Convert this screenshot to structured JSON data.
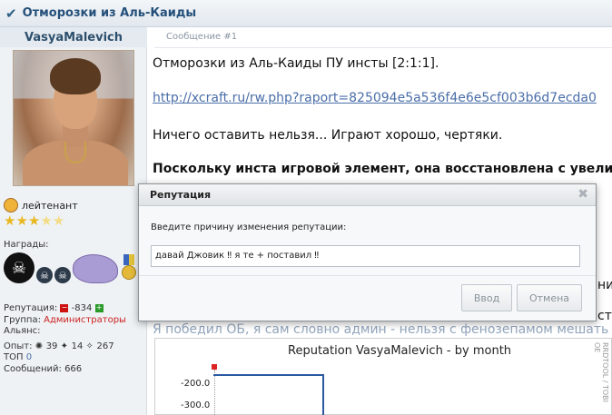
{
  "thread": {
    "title": "Отморозки из Аль-Каиды"
  },
  "user": {
    "name": "VasyaMalevich",
    "rank": "лейтенант",
    "awards_label": "Награды:",
    "reputation_label": "Репутация:",
    "reputation_value": "-834",
    "group_label": "Группа:",
    "group_value": "Администраторы",
    "alliance_label": "Альянс:",
    "exp_label": "Опыт:",
    "exp_values": [
      "39",
      "14",
      "267"
    ],
    "top_label": "ТОП",
    "top_value": "0",
    "messages_label": "Сообщений:",
    "messages_value": "666"
  },
  "post": {
    "label": "Сообщение #1",
    "line1": "Отморозки из Аль-Каиды ПУ инсты [2:1:1].",
    "link": "http://xcraft.ru/rw.php?raport=825094e5a536f4e6e5cf003b6d7ecda0",
    "line3": "Ничего оставить нельзя... Играют хорошо, чертяки.",
    "line4_bold": "Поскольку инста игровой элемент, она восстановлена с увели",
    "frag_right1": "ни",
    "frag_right2": "ст",
    "line_faded": "Я победил ОБ, я сам словно админ - нельзя с фенозепамом мешать н"
  },
  "graph": {
    "title": "Reputation VasyaMalevich - by month",
    "tick_label": "-200.0",
    "tick_label2": "-300.0",
    "side_text": "RRDTOOL / TOBI OE"
  },
  "chart_data": {
    "type": "line",
    "title": "Reputation VasyaMalevich - by month",
    "ytick_labels": [
      "-200.0",
      "-300.0"
    ]
  },
  "modal": {
    "title": "Репутация",
    "prompt": "Введите причину изменения репутации:",
    "input_value": "давай Джовик ‼ я те + поставил ‼",
    "ok_label": "Ввод",
    "cancel_label": "Отмена"
  },
  "colors": {
    "accent": "#24507a",
    "group_red": "#cc1f1f",
    "link": "#4a6ea8"
  }
}
